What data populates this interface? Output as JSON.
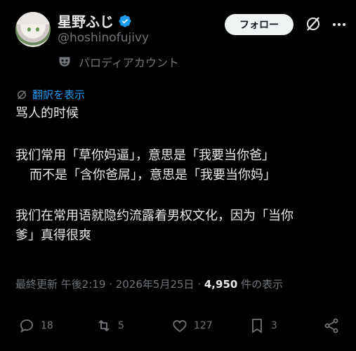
{
  "author": {
    "display_name": "星野ふじ",
    "handle": "@hoshinofujivy",
    "parody_label": "パロディアカウント",
    "verified_color": "#1d9bf0"
  },
  "header": {
    "follow_label": "フォロー",
    "grok_icon": "grok-icon",
    "more_icon": "more-icon"
  },
  "translate": {
    "label": "翻訳を表示",
    "accent": "#1d9bf0"
  },
  "tweet": {
    "lines": [
      "骂人的时候",
      "我们常用「草你妈逼」，意思是「我要当你爸」",
      "而不是「含你爸屌」，意思是「我要当你妈」",
      "我们在常用语就隐约流露着男权文化，因为「当你",
      "爹」真得很爽"
    ]
  },
  "meta": {
    "time_text": "最終更新 午後2:19 · 2026年5月25日 · ",
    "views_count": "4,950",
    "views_label": " 件の表示"
  },
  "actions": {
    "replies": "18",
    "reposts": "5",
    "likes": "127",
    "bookmarks": "3"
  }
}
